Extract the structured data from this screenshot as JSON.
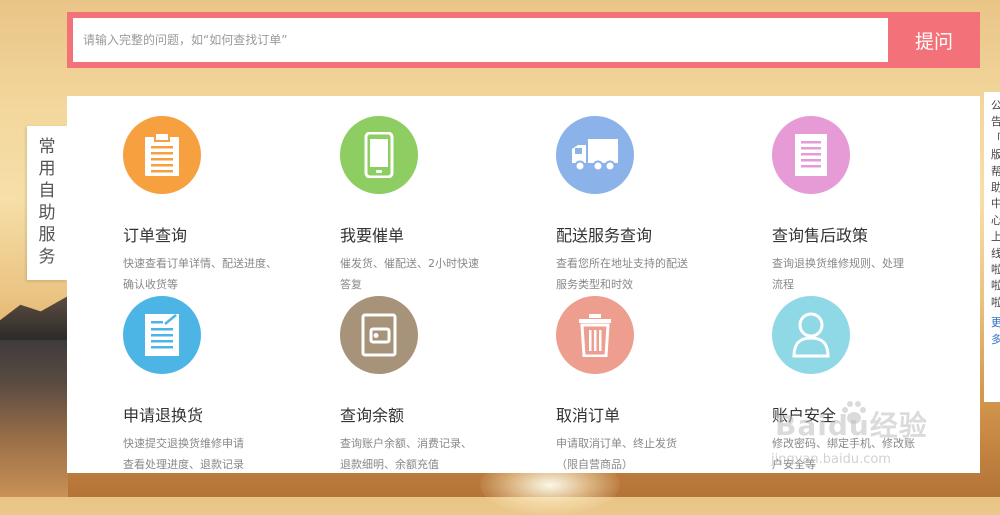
{
  "search": {
    "placeholder": "请输入完整的问题，如“如何查找订单”",
    "button_label": "提问"
  },
  "side_tab": {
    "label": "常用自助服务"
  },
  "services": [
    {
      "icon": "clipboard-icon",
      "color": "#f7a040",
      "title": "订单查询",
      "desc": "快速查看订单详情、配送进度、\n确认收货等"
    },
    {
      "icon": "phone-icon",
      "color": "#8dcd61",
      "title": "我要催单",
      "desc": "催发货、催配送、2小时快速\n答复"
    },
    {
      "icon": "truck-icon",
      "color": "#8bb2e9",
      "title": "配送服务查询",
      "desc": "查看您所在地址支持的配送\n服务类型和时效"
    },
    {
      "icon": "document-icon",
      "color": "#e69bd6",
      "title": "查询售后政策",
      "desc": "查询退换货维修规则、处理\n流程"
    },
    {
      "icon": "edit-document-icon",
      "color": "#4db5e5",
      "title": "申请退换货",
      "desc": "快速提交退换货维修申请\n查看处理进度、退款记录"
    },
    {
      "icon": "wallet-icon",
      "color": "#a7927a",
      "title": "查询余额",
      "desc": "查询账户余额、消费记录、\n退款细明、余额充值"
    },
    {
      "icon": "trash-icon",
      "color": "#ee9e8e",
      "title": "取消订单",
      "desc": "申请取消订单、终止发货\n（限自营商品）"
    },
    {
      "icon": "user-icon",
      "color": "#8fd9e7",
      "title": "账户安全",
      "desc": "修改密码、绑定手机、修改账\n户安全等"
    }
  ],
  "right_panel": {
    "text": "公告「新版帮助中心上线啦啦啦」",
    "link": "更多"
  },
  "watermark": {
    "brand": "Baidu经验",
    "url": "jingyan.baidu.com"
  }
}
